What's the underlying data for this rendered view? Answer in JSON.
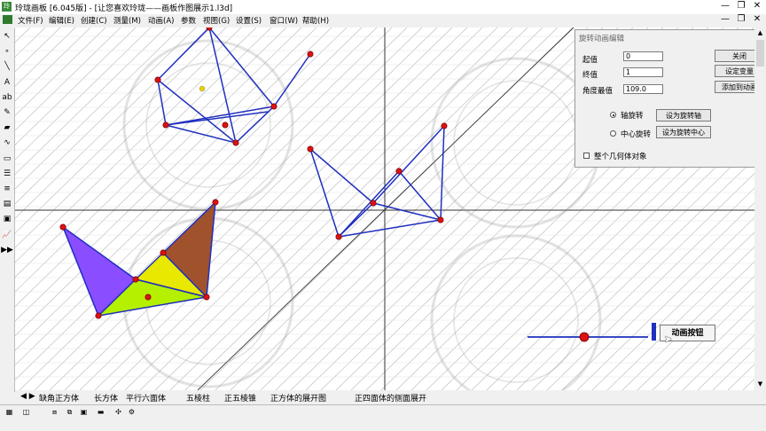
{
  "window": {
    "icon_text": "玲",
    "title": "玲珑画板 [6.045版] - [让您喜欢玲珑——画板作图展示1.l3d]",
    "controls": {
      "minimize": "—",
      "maximize": "❐",
      "close": "✕"
    }
  },
  "menubar": {
    "items": [
      "文件(F)",
      "编辑(E)",
      "创建(C)",
      "测量(M)",
      "动画(A)",
      "参数",
      "视图(G)",
      "设置(S)",
      "窗口(W)",
      "帮助(H)"
    ],
    "right_controls": {
      "minimize": "—",
      "restore": "❐",
      "close": "✕"
    }
  },
  "toolbox": {
    "tools": [
      {
        "name": "select-tool-icon",
        "glyph": "↖"
      },
      {
        "name": "point-tool-icon",
        "glyph": "∘"
      },
      {
        "name": "line-tool-icon",
        "glyph": "╲"
      },
      {
        "name": "text-tool-icon",
        "glyph": "A"
      },
      {
        "name": "label-tool-icon",
        "glyph": "ab"
      },
      {
        "name": "pencil-tool-icon",
        "glyph": "✎"
      },
      {
        "name": "eraser-tool-icon",
        "glyph": "▰"
      },
      {
        "name": "curve-tool-icon",
        "glyph": "∿"
      },
      {
        "name": "rectangle-tool-icon",
        "glyph": "▭"
      },
      {
        "name": "menu-lines-tool-icon",
        "glyph": "☰"
      },
      {
        "name": "list-tool-icon",
        "glyph": "≡"
      },
      {
        "name": "grid-tool-icon",
        "glyph": "▤"
      },
      {
        "name": "color-tool-icon",
        "glyph": "▣"
      },
      {
        "name": "chart-tool-icon",
        "glyph": "📈"
      },
      {
        "name": "play-tool-icon",
        "glyph": "▶▶"
      }
    ]
  },
  "dialog": {
    "title": "旋转动画编辑",
    "start_label": "起值",
    "start_value": "0",
    "end_label": "终值",
    "end_value": "1",
    "angle_label": "角度最值",
    "angle_value": "109.0",
    "axis_rotation_label": "轴旋转",
    "center_rotation_label": "中心旋转",
    "whole_object_label": "整个几何体对象",
    "close_button": "关闭",
    "set_variable_button": "设定变量",
    "add_to_animation_button": "添加到动画",
    "set_axis_button": "设为旋转轴",
    "set_center_button": "设为旋转中心"
  },
  "animation_button": {
    "label": "动画按钮"
  },
  "tabs": {
    "items": [
      "缺角正方体",
      "长方体",
      "平行六面体",
      "五棱柱",
      "正五棱锥",
      "正方体的展开图",
      "正四面体的侧面展开"
    ],
    "active_index": 6
  },
  "colors": {
    "axis": "#333333",
    "grid_lines": "#b0b0b0",
    "lines": "#1f2fbf",
    "points": "#dd1111",
    "purple_face": "#8a4dff",
    "yellow_face": "#e8e800",
    "green_face": "#b4f000",
    "brown_face": "#a0522d"
  }
}
